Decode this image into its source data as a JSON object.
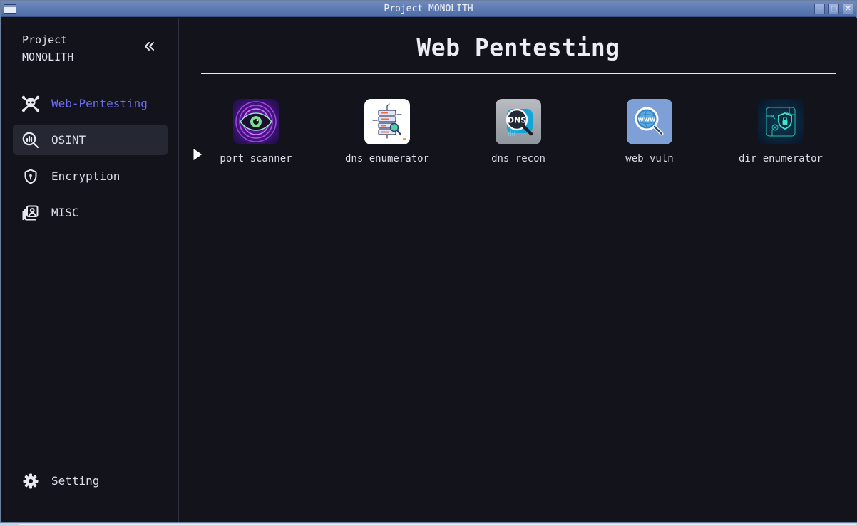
{
  "window": {
    "title": "Project MONOLITH"
  },
  "sidebar": {
    "brand_line1": "Project",
    "brand_line2": "MONOLITH",
    "items": [
      {
        "label": "Web-Pentesting",
        "icon": "skull-crossbones-icon",
        "state": "active"
      },
      {
        "label": "OSINT",
        "icon": "search-chart-icon",
        "state": "hover"
      },
      {
        "label": "Encryption",
        "icon": "shield-icon",
        "state": "normal"
      },
      {
        "label": "MISC",
        "icon": "image-stack-icon",
        "state": "normal"
      }
    ],
    "settings_label": "Setting"
  },
  "main": {
    "title": "Web Pentesting",
    "tools": [
      {
        "label": "port scanner",
        "icon": "eye-radar-icon"
      },
      {
        "label": "dns enumerator",
        "icon": "server-magnifier-icon"
      },
      {
        "label": "dns recon",
        "icon": "dns-magnifier-icon"
      },
      {
        "label": "web vuln",
        "icon": "www-magnifier-icon"
      },
      {
        "label": "dir enumerator",
        "icon": "shield-lock-circuit-icon"
      }
    ]
  },
  "colors": {
    "background": "#12131b",
    "accent": "#6d6cf0",
    "hover": "#252733",
    "text": "#dcdee8"
  }
}
